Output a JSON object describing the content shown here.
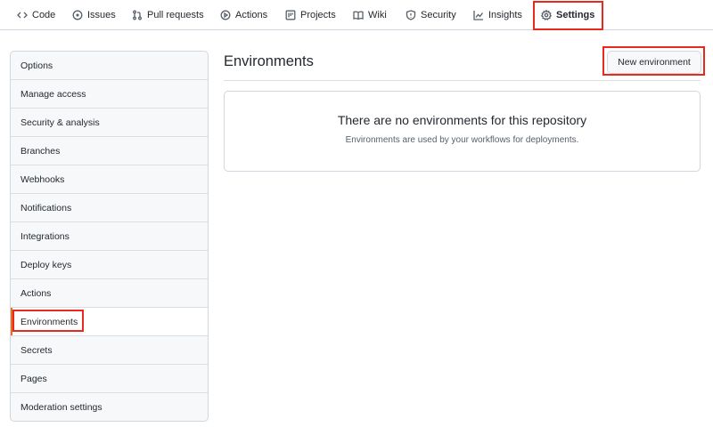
{
  "nav": {
    "tabs": [
      {
        "label": "Code",
        "icon": "code-icon"
      },
      {
        "label": "Issues",
        "icon": "issue-icon"
      },
      {
        "label": "Pull requests",
        "icon": "pull-request-icon"
      },
      {
        "label": "Actions",
        "icon": "play-icon"
      },
      {
        "label": "Projects",
        "icon": "project-icon"
      },
      {
        "label": "Wiki",
        "icon": "book-icon"
      },
      {
        "label": "Security",
        "icon": "shield-icon"
      },
      {
        "label": "Insights",
        "icon": "graph-icon"
      },
      {
        "label": "Settings",
        "icon": "gear-icon",
        "selected": true
      }
    ]
  },
  "sidebar": {
    "items": [
      {
        "label": "Options"
      },
      {
        "label": "Manage access"
      },
      {
        "label": "Security & analysis"
      },
      {
        "label": "Branches"
      },
      {
        "label": "Webhooks"
      },
      {
        "label": "Notifications"
      },
      {
        "label": "Integrations"
      },
      {
        "label": "Deploy keys"
      },
      {
        "label": "Actions"
      },
      {
        "label": "Environments",
        "active": true
      },
      {
        "label": "Secrets"
      },
      {
        "label": "Pages"
      },
      {
        "label": "Moderation settings"
      }
    ]
  },
  "main": {
    "title": "Environments",
    "new_button_label": "New environment",
    "blankslate": {
      "heading": "There are no environments for this repository",
      "description": "Environments are used by your workflows for deployments."
    }
  },
  "colors": {
    "highlight": "#e8291c",
    "active_indicator": "#e16f24",
    "border": "#d0d7de"
  }
}
